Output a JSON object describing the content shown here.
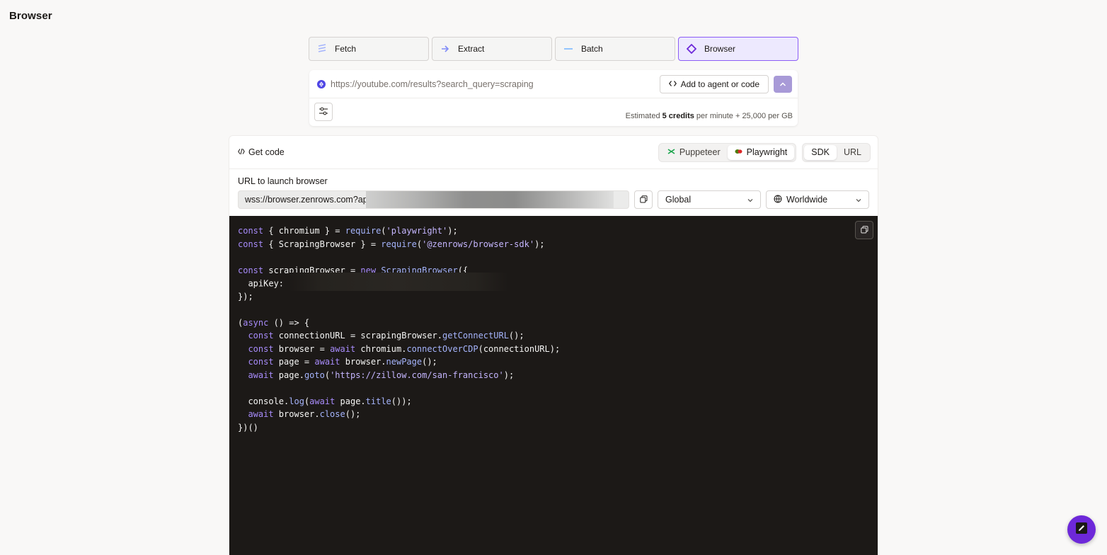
{
  "page": {
    "title": "Browser"
  },
  "tabs": [
    {
      "label": "Fetch",
      "icon": "fetch-icon"
    },
    {
      "label": "Extract",
      "icon": "arrow-right-icon"
    },
    {
      "label": "Batch",
      "icon": "batch-icon"
    },
    {
      "label": "Browser",
      "icon": "diamond-icon",
      "active": true
    }
  ],
  "url_bar": {
    "placeholder": "https://youtube.com/results?search_query=scraping",
    "agent_button": "Add to agent or code",
    "estimate_prefix": "Estimated ",
    "estimate_bold": "5 credits",
    "estimate_suffix": " per minute + 25,000 per GB"
  },
  "code_panel": {
    "title": "Get code",
    "libraries": [
      {
        "label": "Puppeteer",
        "active": false
      },
      {
        "label": "Playwright",
        "active": true
      }
    ],
    "modes": [
      {
        "label": "SDK",
        "active": true
      },
      {
        "label": "URL",
        "active": false
      }
    ],
    "launch_label": "URL to launch browser",
    "wss_value": "wss://browser.zenrows.com?apil",
    "region_select": "Global",
    "country_select": "Worldwide"
  },
  "code": {
    "lines": [
      "const { chromium } = require('playwright');",
      "const { ScrapingBrowser } = require('@zenrows/browser-sdk');",
      "",
      "const scrapingBrowser = new ScrapingBrowser({",
      "  apiKey: ",
      "});",
      "",
      "(async () => {",
      "  const connectionURL = scrapingBrowser.getConnectURL();",
      "  const browser = await chromium.connectOverCDP(connectionURL);",
      "  const page = await browser.newPage();",
      "  await page.goto('https://zillow.com/san-francisco');",
      "",
      "  console.log(await page.title());",
      "  await browser.close();",
      "})()"
    ]
  },
  "colors": {
    "accent": "#8b5cf6",
    "code_bg": "#1c1917",
    "fab": "#6d28d9"
  }
}
